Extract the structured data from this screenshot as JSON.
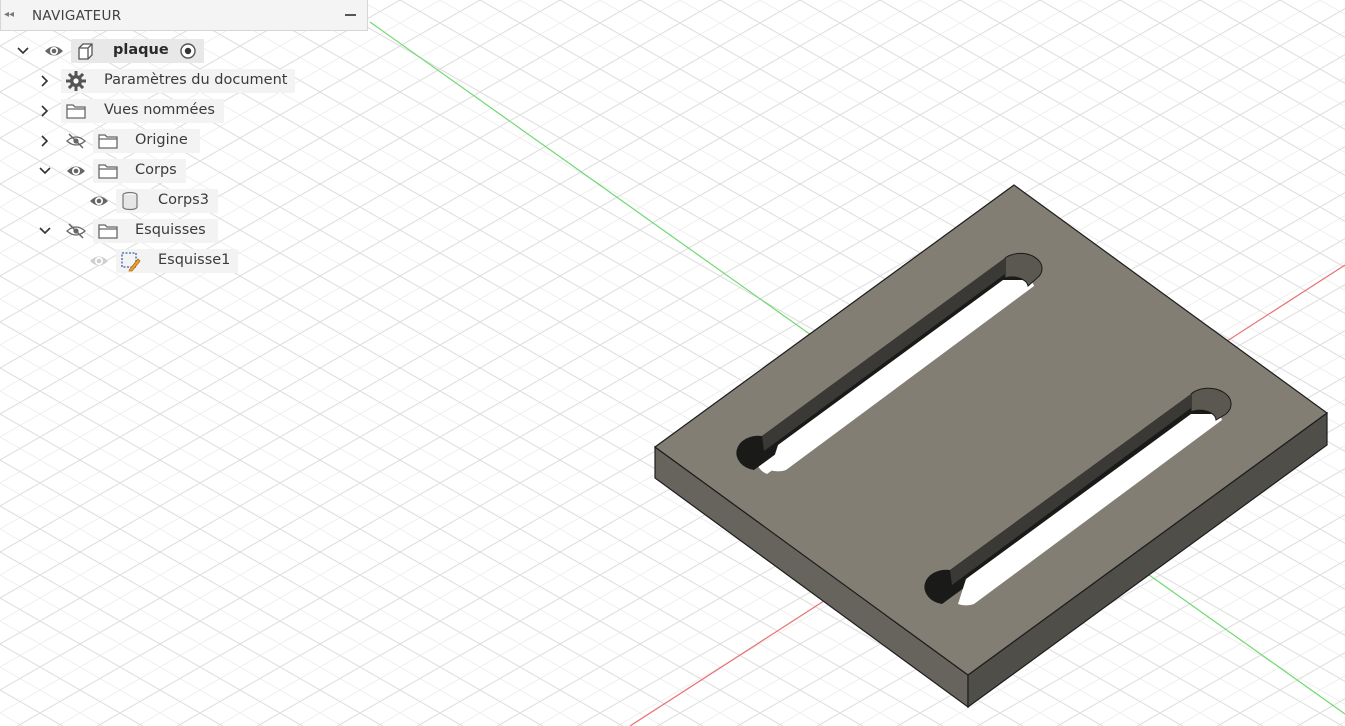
{
  "browser": {
    "title": "NAVIGATEUR",
    "collapse_icon": "double-chevron-left-icon",
    "minimize_icon": "minus-icon",
    "root": {
      "label": "plaque",
      "expanded": true,
      "visible": true,
      "active": true
    },
    "items": [
      {
        "label": "Paramètres du document",
        "icon": "gear-icon",
        "expanded": false
      },
      {
        "label": "Vues nommées",
        "icon": "folder-icon",
        "expanded": false
      },
      {
        "label": "Origine",
        "icon": "folder-icon",
        "expanded": false,
        "visible": false
      },
      {
        "label": "Corps",
        "icon": "folder-icon",
        "expanded": true,
        "visible": true
      },
      {
        "label": "Corps3",
        "icon": "body-icon",
        "visible": true
      },
      {
        "label": "Esquisses",
        "icon": "folder-icon",
        "expanded": true,
        "visible": false
      },
      {
        "label": "Esquisse1",
        "icon": "sketch-icon",
        "visible": true
      }
    ]
  },
  "viewport": {
    "model_name": "plaque",
    "grid_color": "#dcdcdc",
    "x_axis_color": "#e86a6a",
    "y_axis_color": "#6bd86b",
    "face_color": "#827e74",
    "side_color": "#5a5850"
  }
}
